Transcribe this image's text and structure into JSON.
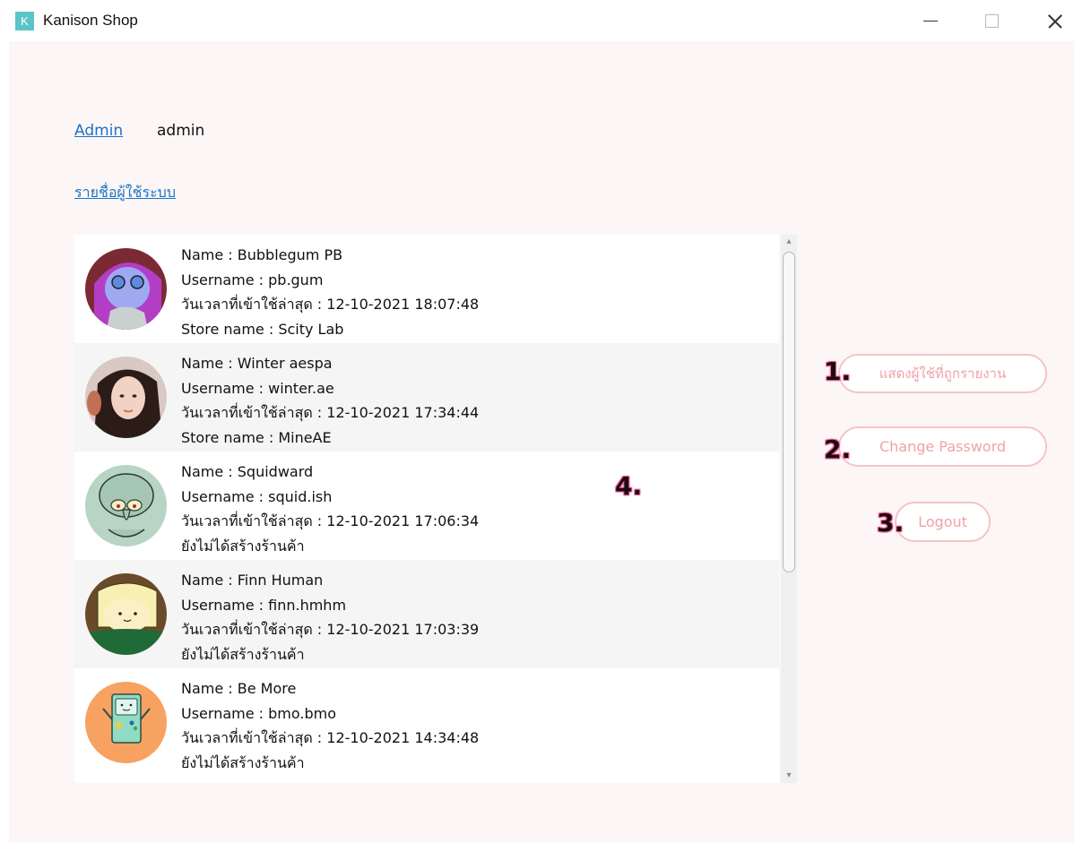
{
  "window": {
    "app_icon_letter": "K",
    "title": "Kanison Shop"
  },
  "nav": {
    "admin_link": "Admin",
    "current_user": "admin",
    "user_list_link": "รายชื่อผู้ใช้ระบบ"
  },
  "users": [
    {
      "name_line": "Name : Bubblegum PB",
      "username_line": "Username : pb.gum",
      "last_login_line": "วันเวลาที่เข้าใช้ล่าสุด : 12-10-2021 18:07:48",
      "store_line": "Store name : Scity Lab",
      "avatar_icon": "purple-character-avatar"
    },
    {
      "name_line": "Name : Winter aespa",
      "username_line": "Username : winter.ae",
      "last_login_line": "วันเวลาที่เข้าใช้ล่าสุด : 12-10-2021 17:34:44",
      "store_line": "Store name : MineAE",
      "avatar_icon": "photo-avatar"
    },
    {
      "name_line": "Name : Squidward",
      "username_line": "Username : squid.ish",
      "last_login_line": "วันเวลาที่เข้าใช้ล่าสุด : 12-10-2021 17:06:34",
      "store_line": "ยังไม่ได้สร้างร้านค้า",
      "avatar_icon": "squid-character-avatar"
    },
    {
      "name_line": "Name : Finn Human",
      "username_line": "Username : finn.hmhm",
      "last_login_line": "วันเวลาที่เข้าใช้ล่าสุด : 12-10-2021 17:03:39",
      "store_line": "ยังไม่ได้สร้างร้านค้า",
      "avatar_icon": "finn-character-avatar"
    },
    {
      "name_line": "Name : Be More",
      "username_line": "Username : bmo.bmo",
      "last_login_line": "วันเวลาที่เข้าใช้ล่าสุด : 12-10-2021 14:34:48",
      "store_line": "ยังไม่ได้สร้างร้านค้า",
      "avatar_icon": "bmo-character-avatar"
    }
  ],
  "actions": {
    "show_reported_users": "แสดงผู้ใช้ที่ถูกรายงาน",
    "change_password": "Change Password",
    "logout": "Logout"
  },
  "annotations": {
    "one": "1.",
    "two": "2.",
    "three": "3.",
    "four": "4."
  },
  "colors": {
    "accent_link": "#1a73c9",
    "button_border": "#f5c4c8",
    "button_text": "#f0a2a8",
    "annotation_glow": "#f06aa2",
    "background": "#fcf7f6"
  }
}
